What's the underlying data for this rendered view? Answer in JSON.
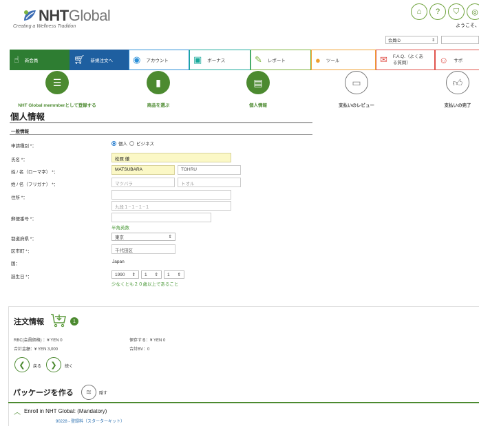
{
  "header": {
    "brand": "NHT",
    "brand_suffix": "Global",
    "tagline": "Creating a Wellness Tradition",
    "welcome": "ようこそ、",
    "member_select": "会員ID",
    "icons": [
      "home-icon",
      "chat-icon",
      "cart-icon",
      "globe-icon"
    ]
  },
  "nav": {
    "items": [
      {
        "label": "新会員",
        "icon": "hand-icon"
      },
      {
        "label": "新規注文へ",
        "icon": "cart-icon"
      },
      {
        "label": "アカウント",
        "icon": "account-icon"
      },
      {
        "label": "ボーナス",
        "icon": "bonus-icon"
      },
      {
        "label": "レポート",
        "icon": "report-icon"
      },
      {
        "label": "ツール",
        "icon": "bulb-icon"
      },
      {
        "label": "F.A.Q.（よくある質問）",
        "icon": "faq-icon"
      },
      {
        "label": "サポ",
        "icon": "support-icon"
      }
    ]
  },
  "steps": [
    {
      "label": "NHT Global memmberとして登録する",
      "state": "active"
    },
    {
      "label": "商品を選ぶ",
      "state": "active"
    },
    {
      "label": "個人情報",
      "state": "active"
    },
    {
      "label": "支払いのレビュー",
      "state": "inactive"
    },
    {
      "label": "支払いの完了",
      "state": "inactive"
    }
  ],
  "page": {
    "title": "個人情報",
    "section": "一般情報"
  },
  "form": {
    "application_type_label": "申請種別 *：",
    "individual": "個人",
    "business": "ビジネス",
    "name_label": "氏名 *：",
    "name_value": "松原  徹",
    "romaji_label": "姓 / 名（ローマ字） *：",
    "romaji_last": "MATSUBARA",
    "romaji_first": "TOHRU",
    "furigana_label": "姓 / 名（フリガナ） *：",
    "furigana_last": "マツバラ",
    "furigana_first": "トオル",
    "address_label": "住所 *：",
    "address_line1": "",
    "address_line2": "九段１−１−１−１",
    "postal_label": "郵便番号 *：",
    "postal_value": "",
    "postal_note": "半角英数",
    "prefecture_label": "都道府県 *：",
    "prefecture_value": "東京",
    "city_label": "区市町 *：",
    "city_value": "千代田区",
    "country_label": "国：",
    "country_value": "Japan",
    "birthday_label": "誕生日 *：",
    "birth_year": "1990",
    "birth_month": "1",
    "birth_day": "1",
    "birthday_note": "少なくとも２０歳以上であること"
  },
  "order": {
    "title": "注文情報",
    "cart_count": "1",
    "rbc": "RBC(会員価格) ：¥ YEN 0",
    "save": "保存する：¥ YEN 0",
    "total": "合計金額：¥ YEN 3,000",
    "total_bv": "合計BV：0",
    "back": "戻る",
    "next": "続く"
  },
  "package": {
    "title": "パッケージを作る",
    "hide": "隠す",
    "enroll": "Enroll in NHT Global: (Mandatory)",
    "item": "90228 - 登録料（スターターキット）"
  }
}
